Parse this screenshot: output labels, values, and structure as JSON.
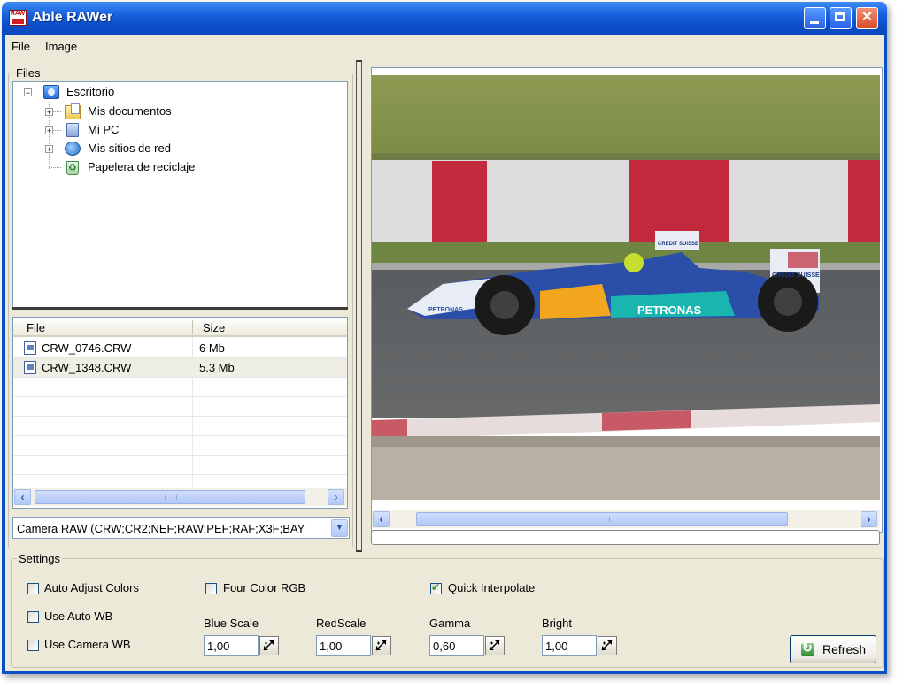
{
  "window": {
    "title": "Able RAWer",
    "icon": "app-icon"
  },
  "menu": {
    "items": [
      "File",
      "Image"
    ]
  },
  "files_panel": {
    "group_title": "Files",
    "tree": [
      {
        "label": "Escritorio",
        "icon": "desktop-icon",
        "expanded": true
      },
      {
        "label": "Mis documentos",
        "icon": "folder-documents-icon",
        "expanded": false
      },
      {
        "label": "Mi PC",
        "icon": "computer-icon",
        "expanded": false
      },
      {
        "label": "Mis sitios de red",
        "icon": "network-icon",
        "expanded": false
      },
      {
        "label": "Papelera de reciclaje",
        "icon": "recycle-bin-icon",
        "expanded": null
      }
    ],
    "file_list": {
      "columns": [
        "File",
        "Size"
      ],
      "rows": [
        {
          "file": "CRW_0746.CRW",
          "size": "6 Mb"
        },
        {
          "file": "CRW_1348.CRW",
          "size": "5.3 Mb"
        }
      ]
    },
    "filter": {
      "selected": "Camera RAW (CRW;CR2;NEF;RAW;PEF;RAF;X3F;BAY"
    }
  },
  "preview": {
    "image_subject": "formula-one-race-car-photo",
    "car_sponsor_texts": [
      "PETRONAS",
      "CREDIT SUISSE"
    ],
    "progress": 0
  },
  "settings": {
    "group_title": "Settings",
    "checkboxes": {
      "auto_adjust_colors": {
        "label": "Auto Adjust Colors",
        "checked": false
      },
      "use_auto_wb": {
        "label": "Use Auto WB",
        "checked": false
      },
      "use_camera_wb": {
        "label": "Use Camera WB",
        "checked": false
      },
      "four_color_rgb": {
        "label": "Four Color RGB",
        "checked": false
      },
      "quick_interpolate": {
        "label": "Quick Interpolate",
        "checked": true
      }
    },
    "fields": {
      "blue_scale": {
        "label": "Blue Scale",
        "value": "1,00"
      },
      "red_scale": {
        "label": "RedScale",
        "value": "1,00"
      },
      "gamma": {
        "label": "Gamma",
        "value": "0,60"
      },
      "bright": {
        "label": "Bright",
        "value": "1,00"
      }
    },
    "refresh_label": "Refresh"
  },
  "colors": {
    "title_bar": "#0a4ec8",
    "window_bg": "#ece9d8",
    "checkbox_check": "#21a121",
    "scroll_thumb": "#b2c8f8"
  }
}
